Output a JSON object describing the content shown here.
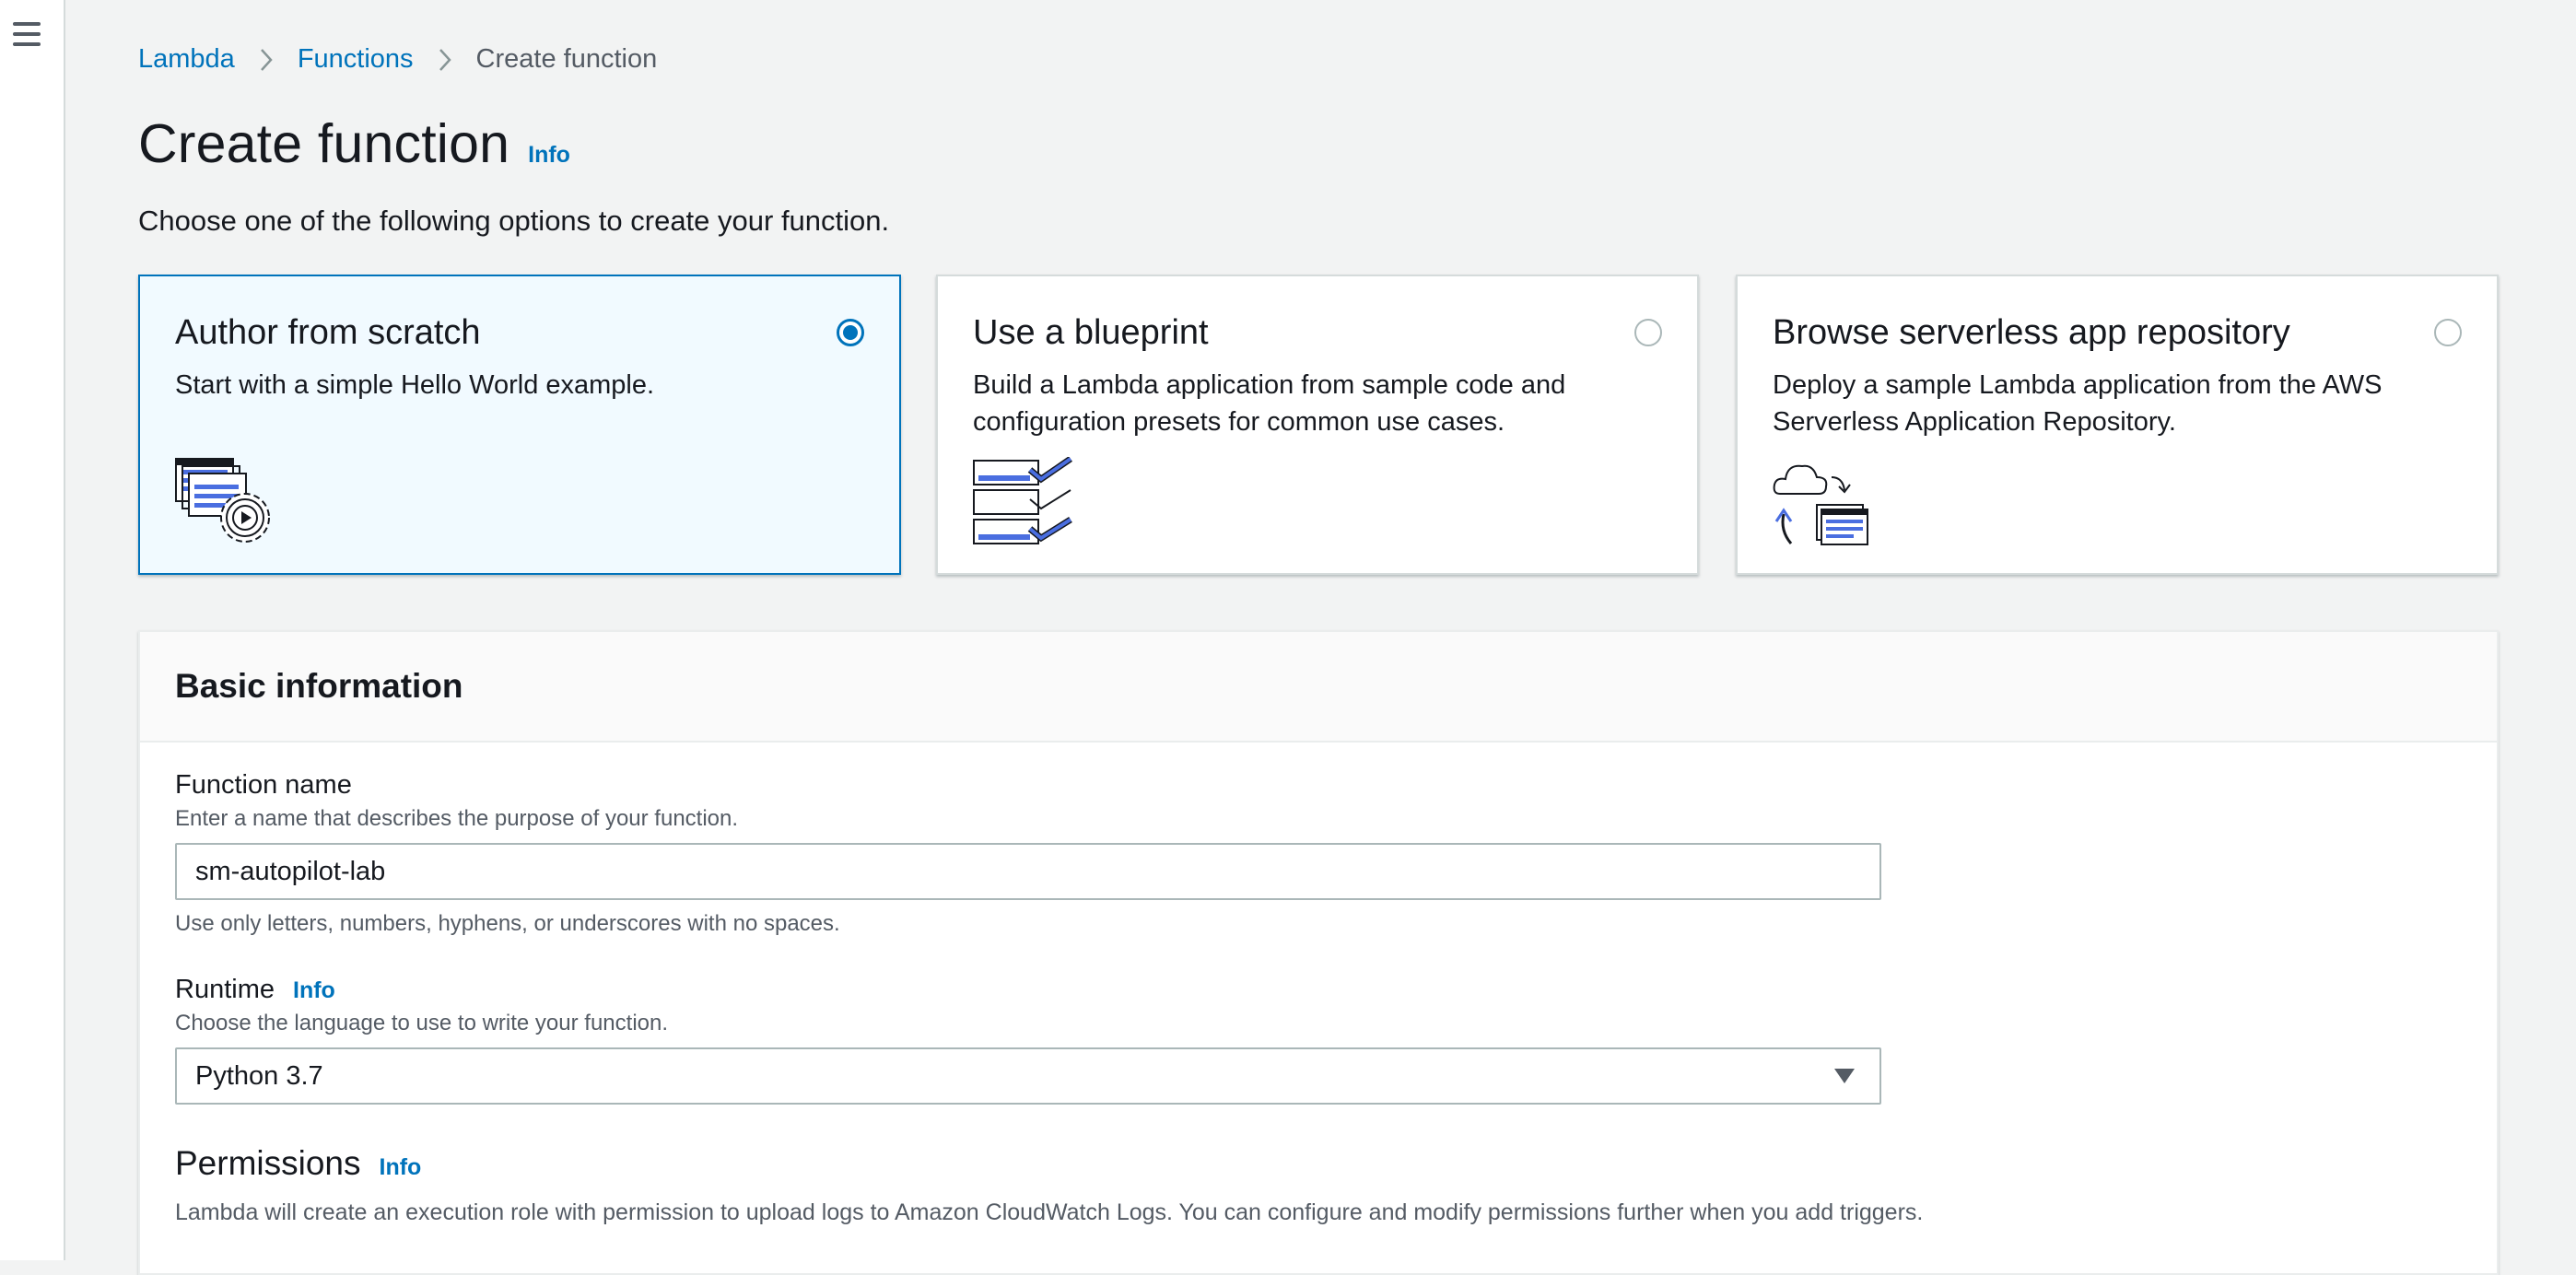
{
  "breadcrumb": {
    "items": [
      {
        "label": "Lambda"
      },
      {
        "label": "Functions"
      },
      {
        "label": "Create function"
      }
    ]
  },
  "header": {
    "title": "Create function",
    "info_label": "Info",
    "subtitle": "Choose one of the following options to create your function."
  },
  "options": [
    {
      "title": "Author from scratch",
      "description": "Start with a simple Hello World example.",
      "selected": true,
      "icon": "author-from-scratch-icon"
    },
    {
      "title": "Use a blueprint",
      "description": "Build a Lambda application from sample code and configuration presets for common use cases.",
      "selected": false,
      "icon": "blueprint-icon"
    },
    {
      "title": "Browse serverless app repository",
      "description": "Deploy a sample Lambda application from the AWS Serverless Application Repository.",
      "selected": false,
      "icon": "serverless-repo-icon"
    }
  ],
  "basic_info": {
    "title": "Basic information",
    "function_name": {
      "label": "Function name",
      "description": "Enter a name that describes the purpose of your function.",
      "value": "sm-autopilot-lab",
      "constraint": "Use only letters, numbers, hyphens, or underscores with no spaces."
    },
    "runtime": {
      "label": "Runtime",
      "info_label": "Info",
      "description": "Choose the language to use to write your function.",
      "selected": "Python 3.7"
    },
    "permissions": {
      "title": "Permissions",
      "info_label": "Info",
      "description": "Lambda will create an execution role with permission to upload logs to Amazon CloudWatch Logs. You can configure and modify permissions further when you add triggers."
    }
  },
  "colors": {
    "accent": "#0073bb",
    "page_background": "#f2f3f3",
    "selected_tile_background": "#f1faff",
    "text": "#16191f",
    "secondary_text": "#545b64"
  }
}
